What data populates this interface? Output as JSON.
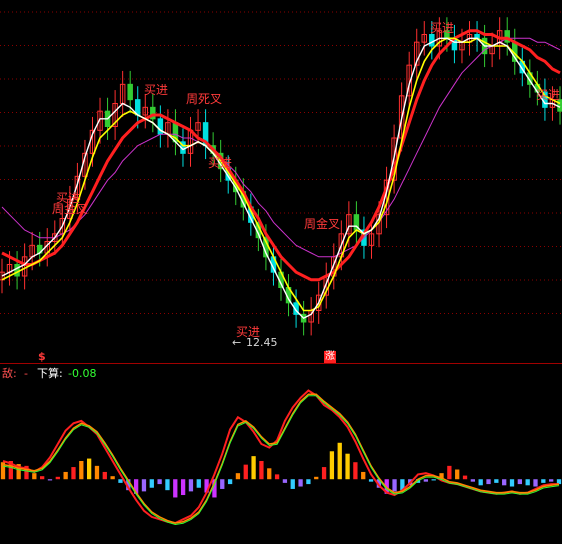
{
  "colors": {
    "background": "#000000",
    "grid": "#8b0000",
    "bull_candle": "#ff3030",
    "bear_candle": "#00e0e0",
    "bear_candle_alt": "#33cc33",
    "ma_fast": "#ffffff",
    "ma_mid": "#ffff00",
    "ma_slow": "#ff2020",
    "ma_long": "#cc33cc",
    "label": "#ff3a3a",
    "sub_label": "#ffffff",
    "sub_value": "#33ff33"
  },
  "signals": {
    "buy_1": "买进",
    "week_cross_1": "周金叉",
    "buy_2": "买进",
    "week_dead": "周死叉",
    "buy_3": "买进",
    "buy_low": "买进",
    "week_cross_2": "周金叉",
    "buy_4": "买进",
    "buy_5": "买进"
  },
  "low_price": "12.45",
  "markers": {
    "dollar": "$",
    "zhang": "涨"
  },
  "sub_panel": {
    "left_label": "敌:",
    "dash": "-",
    "name": "下算:",
    "value": "-0.08"
  },
  "chart_data": [
    {
      "type": "candlestick",
      "title": "",
      "xlabel": "",
      "ylabel": "",
      "grid": true,
      "close": [
        13.9,
        14.1,
        13.8,
        14.3,
        14.6,
        14.4,
        14.7,
        14.9,
        15.3,
        15.8,
        16.4,
        17.0,
        17.6,
        18.1,
        17.7,
        18.3,
        18.8,
        18.4,
        18.0,
        18.2,
        17.9,
        17.5,
        17.8,
        17.3,
        17.0,
        17.6,
        17.8,
        17.2,
        17.0,
        16.6,
        16.3,
        16.0,
        15.6,
        15.2,
        14.8,
        14.3,
        13.9,
        13.5,
        13.1,
        12.8,
        12.6,
        12.9,
        13.3,
        13.8,
        14.3,
        14.9,
        15.4,
        15.0,
        14.6,
        14.9,
        15.4,
        16.3,
        17.4,
        18.5,
        19.3,
        19.9,
        20.1,
        19.8,
        20.2,
        20.0,
        19.7,
        19.9,
        20.1,
        20.0,
        19.6,
        19.8,
        20.2,
        19.9,
        19.4,
        19.1,
        18.8,
        18.6,
        18.2,
        18.4,
        18.1
      ],
      "ma_fast": [
        13.8,
        13.9,
        14.0,
        14.1,
        14.3,
        14.4,
        14.6,
        14.8,
        15.1,
        15.6,
        16.2,
        16.9,
        17.5,
        17.9,
        17.9,
        18.1,
        18.3,
        18.2,
        18.0,
        17.9,
        17.8,
        17.6,
        17.5,
        17.3,
        17.1,
        17.2,
        17.3,
        17.2,
        17.0,
        16.7,
        16.4,
        16.1,
        15.7,
        15.3,
        14.9,
        14.4,
        14.0,
        13.6,
        13.2,
        12.9,
        12.7,
        12.8,
        13.1,
        13.6,
        14.1,
        14.6,
        15.1,
        15.1,
        14.9,
        15.0,
        15.3,
        16.0,
        16.9,
        17.9,
        18.8,
        19.4,
        19.8,
        19.9,
        20.0,
        20.0,
        19.9,
        19.9,
        20.0,
        20.0,
        19.8,
        19.8,
        19.9,
        19.8,
        19.5,
        19.2,
        18.9,
        18.6,
        18.3,
        18.3,
        18.2
      ],
      "ma_mid": [
        13.7,
        13.8,
        13.9,
        14.0,
        14.1,
        14.2,
        14.4,
        14.6,
        14.8,
        15.2,
        15.7,
        16.3,
        16.9,
        17.4,
        17.6,
        17.8,
        18.0,
        18.1,
        18.0,
        17.9,
        17.8,
        17.6,
        17.5,
        17.4,
        17.2,
        17.2,
        17.3,
        17.2,
        17.0,
        16.8,
        16.5,
        16.2,
        15.9,
        15.5,
        15.1,
        14.7,
        14.3,
        13.9,
        13.5,
        13.2,
        12.9,
        12.9,
        13.0,
        13.4,
        13.8,
        14.3,
        14.8,
        15.0,
        14.9,
        15.0,
        15.2,
        15.7,
        16.4,
        17.3,
        18.2,
        18.9,
        19.4,
        19.7,
        19.9,
        20.0,
        20.0,
        19.9,
        19.9,
        20.0,
        19.9,
        19.8,
        19.8,
        19.8,
        19.6,
        19.4,
        19.1,
        18.8,
        18.5,
        18.4,
        18.3
      ],
      "ma_slow": [
        14.4,
        14.3,
        14.2,
        14.1,
        14.1,
        14.2,
        14.3,
        14.4,
        14.6,
        14.9,
        15.2,
        15.6,
        16.0,
        16.4,
        16.8,
        17.1,
        17.4,
        17.6,
        17.8,
        17.9,
        18.0,
        18.0,
        17.9,
        17.8,
        17.7,
        17.6,
        17.4,
        17.3,
        17.1,
        16.9,
        16.6,
        16.3,
        16.0,
        15.6,
        15.3,
        14.9,
        14.6,
        14.3,
        14.1,
        13.9,
        13.8,
        13.7,
        13.7,
        13.8,
        13.9,
        14.1,
        14.3,
        14.6,
        14.9,
        15.2,
        15.6,
        16.1,
        16.6,
        17.2,
        17.8,
        18.4,
        18.9,
        19.3,
        19.6,
        19.8,
        20.0,
        20.1,
        20.2,
        20.2,
        20.1,
        20.1,
        20.0,
        20.0,
        19.9,
        19.8,
        19.7,
        19.5,
        19.4,
        19.2,
        19.1
      ],
      "ma_long": [
        15.6,
        15.4,
        15.2,
        15.0,
        14.9,
        14.8,
        14.8,
        14.8,
        14.9,
        15.0,
        15.2,
        15.4,
        15.7,
        16.0,
        16.3,
        16.5,
        16.8,
        17.0,
        17.2,
        17.3,
        17.4,
        17.5,
        17.5,
        17.5,
        17.4,
        17.4,
        17.3,
        17.2,
        17.0,
        16.9,
        16.7,
        16.5,
        16.2,
        16.0,
        15.7,
        15.5,
        15.2,
        15.0,
        14.8,
        14.6,
        14.5,
        14.4,
        14.3,
        14.3,
        14.3,
        14.4,
        14.5,
        14.6,
        14.8,
        15.0,
        15.2,
        15.5,
        15.8,
        16.2,
        16.6,
        17.0,
        17.4,
        17.8,
        18.2,
        18.5,
        18.8,
        19.1,
        19.3,
        19.5,
        19.7,
        19.8,
        19.9,
        20.0,
        20.0,
        20.0,
        20.0,
        19.9,
        19.9,
        19.8,
        19.7
      ],
      "ylim": [
        12.0,
        21.0
      ],
      "low_marker": 12.45
    },
    {
      "type": "bar",
      "title": "",
      "name": "下算",
      "last_value": -0.08,
      "values": [
        0.28,
        0.3,
        0.25,
        0.22,
        0.1,
        0.05,
        -0.02,
        0.04,
        0.12,
        0.2,
        0.3,
        0.34,
        0.22,
        0.12,
        0.05,
        -0.06,
        -0.18,
        -0.24,
        -0.2,
        -0.14,
        -0.08,
        -0.18,
        -0.3,
        -0.26,
        -0.2,
        -0.14,
        -0.22,
        -0.3,
        -0.16,
        -0.08,
        0.1,
        0.24,
        0.38,
        0.3,
        0.18,
        0.08,
        -0.06,
        -0.16,
        -0.12,
        -0.08,
        0.04,
        0.2,
        0.46,
        0.6,
        0.42,
        0.28,
        0.12,
        -0.04,
        -0.14,
        -0.24,
        -0.2,
        -0.18,
        -0.1,
        -0.06,
        -0.04,
        -0.02,
        0.1,
        0.22,
        0.16,
        0.06,
        -0.04,
        -0.1,
        -0.08,
        -0.06,
        -0.1,
        -0.12,
        -0.08,
        -0.1,
        -0.12,
        -0.06,
        -0.04,
        -0.08
      ],
      "line_a": [
        0.3,
        0.26,
        0.2,
        0.18,
        0.12,
        0.2,
        0.36,
        0.58,
        0.8,
        0.92,
        0.96,
        0.86,
        0.74,
        0.52,
        0.3,
        0.08,
        -0.14,
        -0.34,
        -0.52,
        -0.62,
        -0.66,
        -0.7,
        -0.72,
        -0.66,
        -0.6,
        -0.46,
        -0.22,
        0.08,
        0.42,
        0.82,
        1.02,
        0.94,
        0.78,
        0.58,
        0.52,
        0.64,
        0.96,
        1.18,
        1.34,
        1.46,
        1.38,
        1.22,
        1.14,
        1.02,
        0.86,
        0.62,
        0.34,
        0.08,
        -0.1,
        -0.22,
        -0.26,
        -0.18,
        -0.06,
        0.08,
        0.1,
        0.06,
        -0.02,
        -0.06,
        -0.08,
        -0.12,
        -0.16,
        -0.2,
        -0.22,
        -0.24,
        -0.22,
        -0.2,
        -0.24,
        -0.22,
        -0.16,
        -0.1,
        -0.08,
        -0.08
      ],
      "line_b": [
        0.24,
        0.22,
        0.18,
        0.16,
        0.14,
        0.18,
        0.3,
        0.48,
        0.68,
        0.84,
        0.92,
        0.88,
        0.78,
        0.6,
        0.4,
        0.18,
        -0.02,
        -0.22,
        -0.4,
        -0.54,
        -0.62,
        -0.68,
        -0.72,
        -0.7,
        -0.64,
        -0.54,
        -0.34,
        -0.06,
        0.26,
        0.62,
        0.9,
        0.96,
        0.86,
        0.7,
        0.58,
        0.6,
        0.84,
        1.08,
        1.28,
        1.4,
        1.4,
        1.28,
        1.18,
        1.08,
        0.94,
        0.74,
        0.48,
        0.22,
        0.02,
        -0.14,
        -0.22,
        -0.2,
        -0.12,
        0.0,
        0.06,
        0.06,
        0.02,
        -0.04,
        -0.06,
        -0.1,
        -0.14,
        -0.18,
        -0.2,
        -0.22,
        -0.22,
        -0.2,
        -0.22,
        -0.22,
        -0.18,
        -0.12,
        -0.1,
        -0.08
      ],
      "ylim": [
        -1.0,
        1.6
      ]
    }
  ]
}
